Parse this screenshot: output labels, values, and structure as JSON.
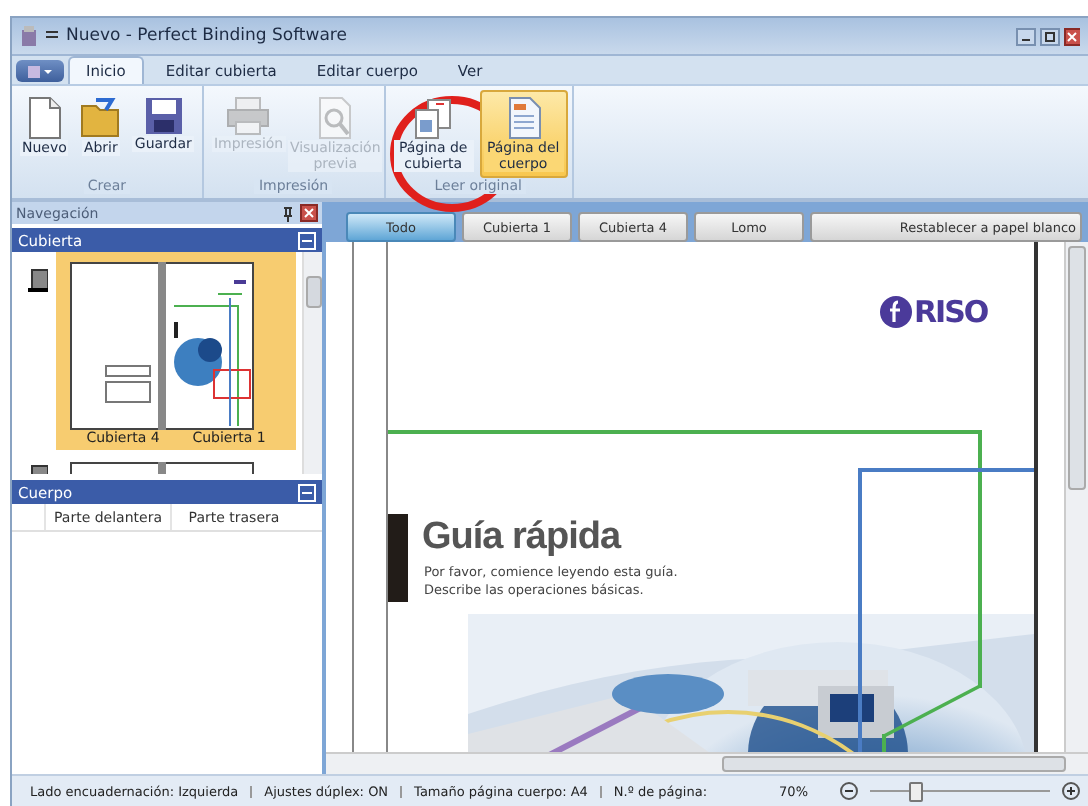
{
  "window": {
    "title": "Nuevo - Perfect Binding Software"
  },
  "ribbon_tabs": [
    {
      "label": "Inicio",
      "selected": true
    },
    {
      "label": "Editar cubierta",
      "selected": false
    },
    {
      "label": "Editar cuerpo",
      "selected": false
    },
    {
      "label": "Ver",
      "selected": false
    }
  ],
  "ribbon_groups": [
    {
      "label": "Crear",
      "buttons": [
        {
          "label": "Nuevo",
          "kind": "new",
          "disabled": false,
          "selected": false
        },
        {
          "label": "Abrir",
          "kind": "open",
          "disabled": false,
          "selected": false
        },
        {
          "label": "Guardar",
          "kind": "save",
          "disabled": false,
          "selected": false
        }
      ]
    },
    {
      "label": "Impresión",
      "buttons": [
        {
          "label": "Impresión",
          "kind": "print",
          "disabled": true,
          "selected": false
        },
        {
          "label": "Visualización previa",
          "kind": "preview",
          "disabled": true,
          "selected": false
        }
      ]
    },
    {
      "label": "Leer original",
      "buttons": [
        {
          "label": "Página de cubierta",
          "kind": "cover",
          "disabled": false,
          "selected": false
        },
        {
          "label": "Página del cuerpo",
          "kind": "body",
          "disabled": false,
          "selected": true
        }
      ]
    }
  ],
  "navigation": {
    "title": "Navegación",
    "cover_section": {
      "title": "Cubierta",
      "thumbnails": [
        {
          "labels": [
            "Cubierta 4",
            "Cubierta 1"
          ],
          "selected": true
        }
      ]
    },
    "body_section": {
      "title": "Cuerpo",
      "columns": [
        "Parte delantera",
        "Parte trasera"
      ]
    }
  },
  "view_buttons": [
    {
      "label": "Todo",
      "selected": true
    },
    {
      "label": "Cubierta 1",
      "selected": false
    },
    {
      "label": "Cubierta 4",
      "selected": false
    },
    {
      "label": "Lomo",
      "selected": false
    },
    {
      "label": "Restablecer a papel blanco",
      "selected": false
    }
  ],
  "document": {
    "logo_text": "RISO",
    "heading": "Guía rápida",
    "lines": [
      "Por favor, comience leyendo esta guía.",
      "Describe las operaciones básicas."
    ]
  },
  "status_bar": {
    "items": [
      "Lado encuadernación: Izquierda",
      "Ajustes dúplex: ON",
      "Tamaño página cuerpo: A4",
      "N.º de página:"
    ],
    "zoom": "70%",
    "zoom_slider": {
      "level": 0.25
    }
  }
}
